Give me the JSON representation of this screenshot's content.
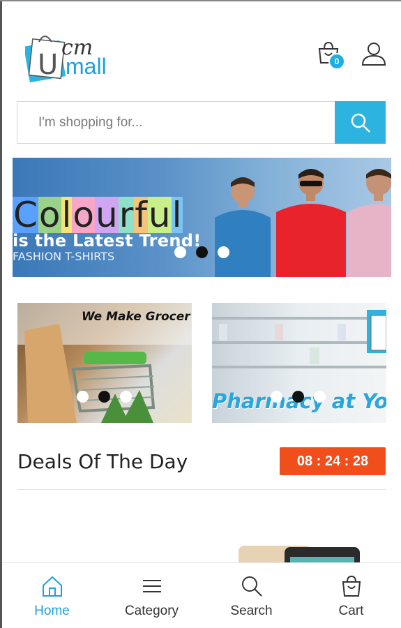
{
  "header": {
    "logo_text_top": "cm",
    "logo_text_bottom": "mall",
    "logo_letter": "U",
    "cart_count": "0"
  },
  "search": {
    "placeholder": "I'm shopping for..."
  },
  "hero": {
    "title_letters": [
      "C",
      "o",
      "l",
      "o",
      "u",
      "r",
      "f",
      "u",
      "l"
    ],
    "line1": "is the Latest Trend!",
    "line2": "FASHION T-SHIRTS"
  },
  "sub_banners": {
    "grocery_text": "We Make Grocer",
    "pharmacy_text": "Pharmacy at Yo"
  },
  "deals": {
    "title": "Deals Of The Day",
    "timer": "08 : 24 : 28"
  },
  "bottom_nav": {
    "home": "Home",
    "category": "Category",
    "search": "Search",
    "cart": "Cart"
  },
  "colors": {
    "accent": "#2db3e0",
    "timer": "#f04e1a",
    "nav_active": "#1e9fdc"
  },
  "icons": [
    "cart-icon",
    "user-icon",
    "search-icon",
    "home-icon",
    "menu-icon",
    "bag-icon"
  ]
}
